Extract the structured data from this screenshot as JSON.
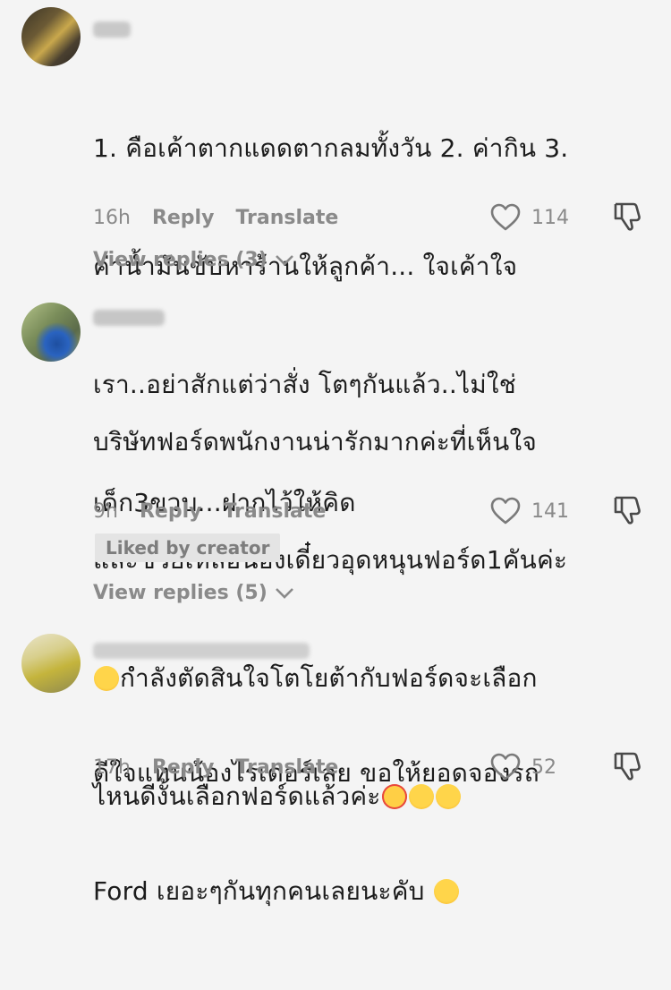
{
  "comments": [
    {
      "text_lines": [
        "1. คือเค้าตากแดดตากลมทั้งวัน 2. ค่ากิน 3.",
        "ค่าน้ำมันขับหาร้านให้ลูกค้า... ใจเค้าใจ",
        "เรา..อย่าสักแต่ว่าสั่ง โตๆกันแล้ว..ไม่ใช่",
        "เด็ก3ขวบ...ฝากไว้ให้คิด"
      ],
      "time": "16h",
      "reply_label": "Reply",
      "translate_label": "Translate",
      "likes": "114",
      "view_replies": "View replies (3)"
    },
    {
      "text_lines": [
        "บริษัทฟอร์ดพนักงานน่ารักมากค่ะที่เห็นใจ",
        "และช่วยเหลือน้องเดี๋ยวอุดหนุนฟอร์ด1คันค่ะ",
        "กำลังตัดสินใจโตโยต้ากับฟอร์ดจะเลือก",
        "ไหนดีงั้นเลือกฟอร์ดแล้วค่ะ"
      ],
      "time": "9h",
      "reply_label": "Reply",
      "translate_label": "Translate",
      "likes": "141",
      "liked_by": "Liked by creator",
      "view_replies": "View replies (5)"
    },
    {
      "text_lines": [
        "ดีใจแทนน้องไรเดอร์เลย ขอให้ยอดจองรถ",
        "Ford เยอะๆกันทุกคนเลยนะคับ"
      ],
      "time": "17h",
      "reply_label": "Reply",
      "translate_label": "Translate",
      "likes": "52"
    }
  ],
  "icons": {
    "like": "heart-outline-icon",
    "dislike": "thumbs-down-icon",
    "expand": "chevron-down-icon"
  },
  "colors": {
    "background": "#f4f4f4",
    "text": "#1c1c1c",
    "muted": "#8a8a8a",
    "badge_bg": "#e4e4e4"
  }
}
